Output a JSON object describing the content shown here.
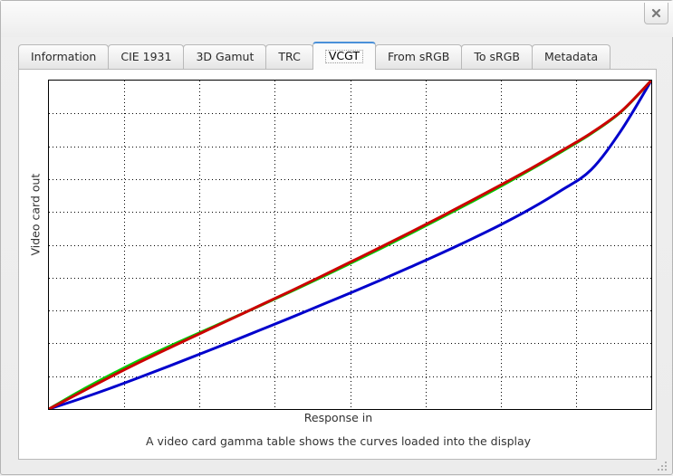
{
  "window": {
    "close_icon": "close-icon",
    "resize_grip_icon": "resize-grip-icon"
  },
  "tabs": [
    {
      "label": "Information",
      "active": false
    },
    {
      "label": "CIE 1931",
      "active": false
    },
    {
      "label": "3D Gamut",
      "active": false
    },
    {
      "label": "TRC",
      "active": false
    },
    {
      "label": "VCGT",
      "active": true
    },
    {
      "label": "From sRGB",
      "active": false
    },
    {
      "label": "To sRGB",
      "active": false
    },
    {
      "label": "Metadata",
      "active": false
    }
  ],
  "panel": {
    "description": "A video card gamma table shows the curves loaded into the display"
  },
  "chart_data": {
    "type": "line",
    "title": "",
    "xlabel": "Response in",
    "ylabel": "Video card out",
    "xlim": [
      0,
      1
    ],
    "ylim": [
      0,
      1
    ],
    "grid": true,
    "grid_style": "dotted",
    "grid_x_divisions": 8,
    "grid_y_divisions": 10,
    "legend": "none",
    "axis_ticks": false,
    "colors": {
      "red": "#cc0000",
      "green": "#00cc00",
      "blue": "#0000cc"
    },
    "line_width": 3,
    "x": [
      0.0,
      0.05,
      0.1,
      0.15,
      0.2,
      0.25,
      0.3,
      0.35,
      0.4,
      0.45,
      0.5,
      0.55,
      0.6,
      0.65,
      0.7,
      0.75,
      0.8,
      0.85,
      0.9,
      0.95,
      1.0
    ],
    "series": [
      {
        "name": "Red",
        "color": "#cc0000",
        "values": [
          0.0,
          0.048,
          0.096,
          0.142,
          0.186,
          0.229,
          0.272,
          0.315,
          0.358,
          0.402,
          0.447,
          0.492,
          0.538,
          0.585,
          0.633,
          0.682,
          0.732,
          0.785,
          0.84,
          0.906,
          1.0
        ]
      },
      {
        "name": "Green",
        "color": "#00cc00",
        "values": [
          0.0,
          0.053,
          0.102,
          0.148,
          0.191,
          0.232,
          0.273,
          0.314,
          0.356,
          0.399,
          0.443,
          0.488,
          0.534,
          0.581,
          0.629,
          0.678,
          0.729,
          0.782,
          0.838,
          0.905,
          1.0
        ]
      },
      {
        "name": "Blue",
        "color": "#0000cc",
        "values": [
          0.0,
          0.03,
          0.062,
          0.096,
          0.131,
          0.167,
          0.203,
          0.24,
          0.277,
          0.315,
          0.353,
          0.392,
          0.432,
          0.473,
          0.516,
          0.561,
          0.61,
          0.665,
          0.728,
          0.848,
          1.0
        ]
      }
    ]
  }
}
